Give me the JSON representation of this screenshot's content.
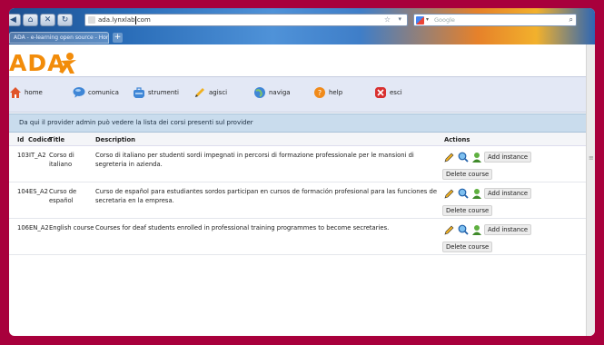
{
  "browser": {
    "url": "ada.lynxlab.com",
    "search_placeholder": "Google",
    "tab_title": "ADA - e-learning open source - Home",
    "new_tab": "+"
  },
  "logo": {
    "text": "ADA"
  },
  "menu": [
    {
      "label": "home",
      "icon": "house-icon",
      "color": "#e0552a"
    },
    {
      "label": "comunica",
      "icon": "chat-bubble-icon",
      "color": "#3f86d6"
    },
    {
      "label": "strumenti",
      "icon": "toolbox-icon",
      "color": "#3f86d6"
    },
    {
      "label": "agisci",
      "icon": "pencil-icon",
      "color": "#f0b020"
    },
    {
      "label": "naviga",
      "icon": "globe-icon",
      "color": "#3f86d6"
    },
    {
      "label": "help",
      "icon": "help-icon",
      "color": "#f08a1a"
    },
    {
      "label": "esci",
      "icon": "exit-icon",
      "color": "#d83030"
    }
  ],
  "info": "Da qui il provider admin può vedere la lista dei corsi presenti sul provider",
  "table": {
    "headers": {
      "id": "Id",
      "code": "Codice",
      "title": "Title",
      "description": "Description",
      "actions": "Actions"
    },
    "rows": [
      {
        "id": "103",
        "code": "IT_A2",
        "title": "Corso di italiano",
        "description": "Corso di italiano per studenti sordi impegnati in percorsi di formazione professionale per le mansioni di segreteria in azienda."
      },
      {
        "id": "104",
        "code": "ES_A2",
        "title": "Curso de español",
        "description": "Curso de español para estudiantes sordos participan en cursos de formación profesional para las funciones de secretaria en la empresa."
      },
      {
        "id": "106",
        "code": "EN_A2",
        "title": "English course",
        "description": "Courses for deaf students enrolled in professional training programmes to become secretaries."
      }
    ],
    "add_instance": "Add instance",
    "delete_course": "Delete course"
  }
}
